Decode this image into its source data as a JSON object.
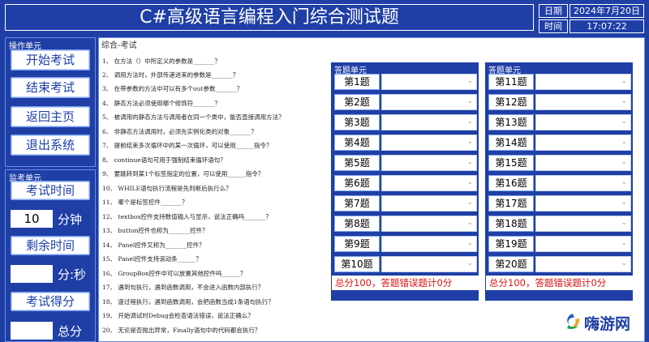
{
  "title": "C#高级语言编程入门综合测试题",
  "info": {
    "date_label": "日期",
    "date_value": "2024年7月20日",
    "time_label": "时间",
    "time_value": "17:07:22"
  },
  "ops": {
    "title": "操作单元",
    "buttons": [
      "开始考试",
      "结束考试",
      "返回主页",
      "退出系统"
    ]
  },
  "monitor": {
    "title": "监考单元",
    "exam_time_button": "考试时间",
    "exam_time_value": "10",
    "exam_time_unit": "分钟",
    "remaining_button": "剩余时间",
    "remaining_value": "",
    "remaining_unit": "分:秒",
    "score_button": "考试得分",
    "score_value": "",
    "score_unit": "总分"
  },
  "main": {
    "title": "综合-考试",
    "questions": [
      "1、  在方法（）中所定义的参数是_______？",
      "2、  调用方法时，外部传递进来的参数是_______？",
      "3、  在带参数的方法中可以有多个out参数_______？",
      "4、  静态方法必须使用哪个修饰符_______？",
      "5、  被调用的静态方法与调用者在同一个类中，能否直接调用方法？",
      "6、  非静态方法调用时，必须先实例化类的对象_______？",
      "7、  提前结束多次循环中的某一次循环，可以使用______指令？",
      "8、  continue语句可用于强制结束循环语句？",
      "9、  要跳转到某1个标签指定的位置，可以使用______指令？",
      "10、  WHILE语句执行流程是先判断后执行么？",
      "11、  哪个是标签控件_______？",
      "12、  textbox控件支持数值输入与显示，说法正确吗_______？",
      "13、  button控件也称为_______控件？",
      "14、  Panel控件又称为_______控件？",
      "15、  Panel控件支持滚动条______？",
      "16、  GroupBox控件中可以放置其他控件吗______？",
      "17、  遇到句执行，遇到函数调用，不会进入函数内部执行？",
      "18、  逐过程执行，遇到函数调用，会把函数当成1条语句执行？",
      "19、  开始调试时Debug会检查语法错误，说法正确么？",
      "20、  无论是否抛出异常，Finally语句中的代码都会执行？"
    ],
    "panel_left": {
      "title": "答题单元",
      "labels": [
        "第1题",
        "第2题",
        "第3题",
        "第4题",
        "第5题",
        "第6题",
        "第7题",
        "第8题",
        "第9题",
        "第10题"
      ],
      "score_text": "总分100，答题错误题计0分"
    },
    "panel_right": {
      "title": "答题单元",
      "labels": [
        "第11题",
        "第12题",
        "第13题",
        "第14题",
        "第15题",
        "第16题",
        "第17题",
        "第18题",
        "第19题",
        "第20题"
      ],
      "score_text": "总分100，答题错误题计0分"
    }
  },
  "logo": {
    "text": "嗨游网"
  },
  "colors": {
    "background": "#1f3fa6",
    "accent_text": "#1b3faa",
    "score_red": "#e01010"
  },
  "icons": {
    "dropdown": "chevron-down-icon"
  }
}
